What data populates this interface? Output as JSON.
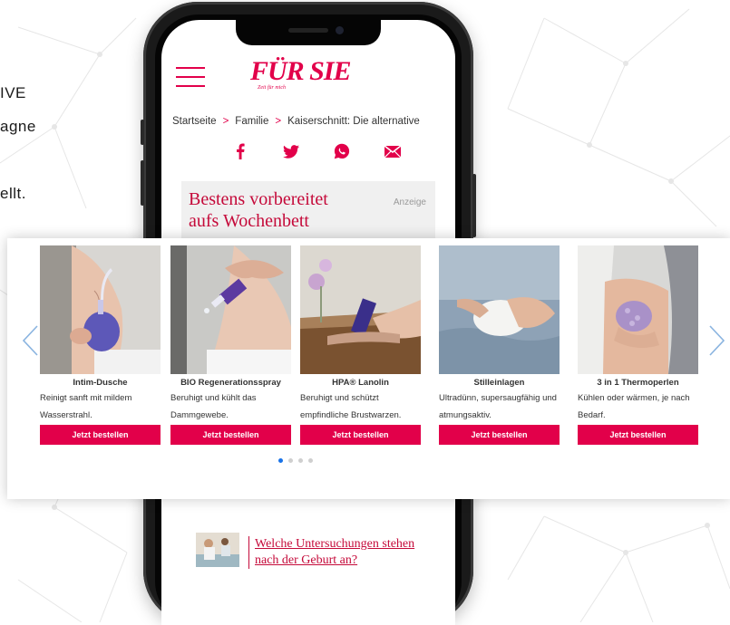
{
  "left_fragments": [
    "IVE",
    "agne",
    "ellt."
  ],
  "site": {
    "logo": "FÜR SIE",
    "logo_sub": "Zeit für mich",
    "breadcrumb": [
      "Startseite",
      "Familie",
      "Kaiserschnitt: Die alternative"
    ],
    "breadcrumb_separator": ">",
    "share_icons": [
      "facebook-icon",
      "twitter-icon",
      "whatsapp-icon",
      "email-icon"
    ]
  },
  "ad": {
    "title": "Bestens vorbereitet aufs Wochenbett",
    "label": "Anzeige"
  },
  "products": [
    {
      "name": "Intim-Dusche",
      "description": "Reinigt sanft mit mildem Wasserstrahl.",
      "button": "Jetzt bestellen"
    },
    {
      "name": "BIO Regenerationsspray",
      "description": "Beruhigt und kühlt das Dammgewebe.",
      "button": "Jetzt bestellen"
    },
    {
      "name": "HPA® Lanolin",
      "description": "Beruhigt und schützt empfindliche Brustwarzen.",
      "button": "Jetzt bestellen"
    },
    {
      "name": "Stilleinlagen",
      "description": "Ultradünn, supersaugfähig und atmungsaktiv.",
      "button": "Jetzt bestellen"
    },
    {
      "name": "3 in 1 Thermoperlen",
      "description": "Kühlen oder wärmen, je nach Bedarf.",
      "button": "Jetzt bestellen"
    }
  ],
  "carousel": {
    "active_page": 1,
    "page_count": 4
  },
  "related_article": {
    "title": "Welche Untersuchungen stehen nach der Geburt an?"
  },
  "colors": {
    "brand": "#e2004a",
    "link": "#c50a3a",
    "dot_active": "#1a73e8",
    "arrow": "#8ab4e0"
  }
}
